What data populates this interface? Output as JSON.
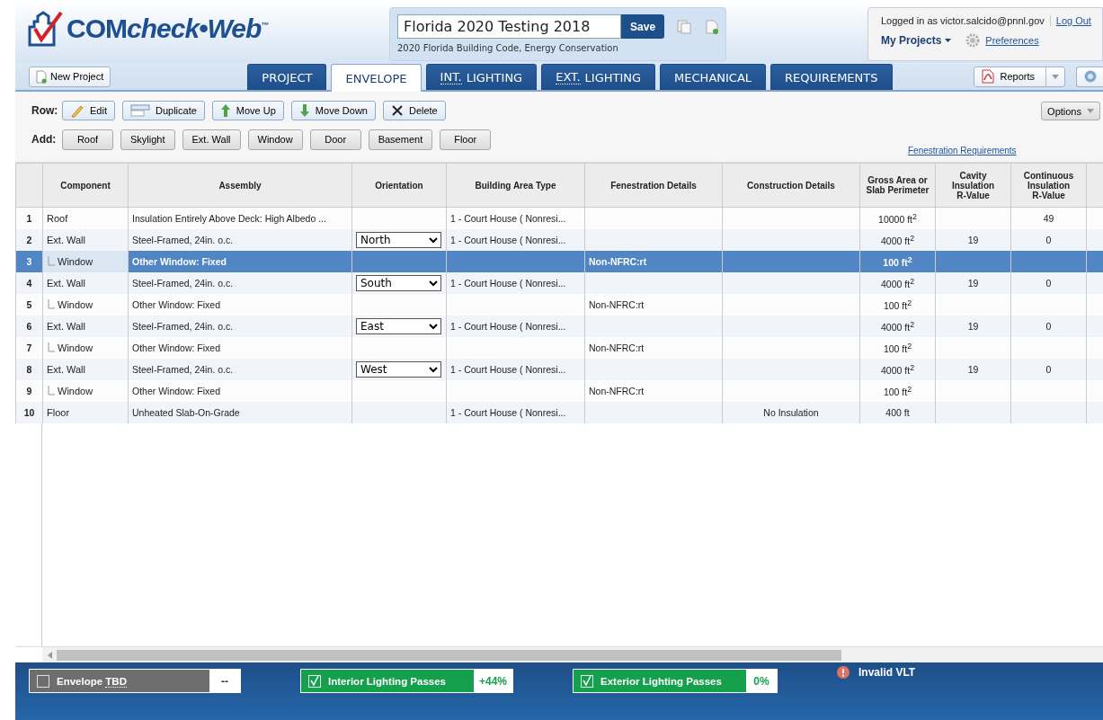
{
  "header": {
    "logo": {
      "main": "COM",
      "rest": "check•Web",
      "tm": "™"
    },
    "project": {
      "name": "Florida 2020 Testing 2018",
      "save": "Save",
      "code": "2020 Florida Building Code, Energy Conservation"
    },
    "user": {
      "logged_in": "Logged in as victor.salcido@pnnl.gov",
      "logout": "Log Out",
      "my_projects": "My Projects",
      "preferences": "Preferences"
    }
  },
  "new_project": "New Project",
  "tabs": [
    {
      "label": "PROJECT",
      "selected": false
    },
    {
      "label": "ENVELOPE",
      "selected": true
    },
    {
      "abbr": "INT.",
      "label": "LIGHTING",
      "selected": false
    },
    {
      "abbr": "EXT.",
      "label": "LIGHTING",
      "selected": false
    },
    {
      "label": "MECHANICAL",
      "selected": false
    },
    {
      "label": "REQUIREMENTS",
      "selected": false
    }
  ],
  "reports": "Reports",
  "row_toolbar": {
    "label": "Row:",
    "buttons": [
      {
        "kind": "edit",
        "label": "Edit"
      },
      {
        "kind": "duplicate",
        "label": "Duplicate"
      },
      {
        "kind": "up",
        "label": "Move Up"
      },
      {
        "kind": "down",
        "label": "Move Down"
      },
      {
        "kind": "delete",
        "label": "Delete"
      }
    ]
  },
  "add_toolbar": {
    "label": "Add:",
    "buttons": [
      "Roof",
      "Skylight",
      "Ext. Wall",
      "Window",
      "Door",
      "Basement",
      "Floor"
    ]
  },
  "options": "Options",
  "fenestration_link": "Fenestration Requirements",
  "table": {
    "columns": [
      "Component",
      "Assembly",
      "Orientation",
      "Building Area Type",
      "Fenestration Details",
      "Construction Details",
      "Gross Area or Slab Perimeter",
      "Cavity Insulation R-Value",
      "Continuous Insulation R-Value"
    ],
    "rows": [
      {
        "num": "1",
        "child": false,
        "selected": false,
        "component": "Roof",
        "assembly": "Insulation Entirely Above Deck: High Albedo ...",
        "orientation": "",
        "area_type": "1 - Court House ( Nonresi...",
        "fenestration": "",
        "construction": "",
        "area": "10000 ft$^{2}$",
        "cavity": "",
        "continuous": "49"
      },
      {
        "num": "2",
        "child": false,
        "selected": false,
        "component": "Ext. Wall",
        "assembly": "Steel-Framed, 24in. o.c.",
        "orientation": "North",
        "area_type": "1 - Court House ( Nonresi...",
        "fenestration": "",
        "construction": "",
        "area": "4000 ft$^{2}$",
        "cavity": "19",
        "continuous": "0"
      },
      {
        "num": "3",
        "child": true,
        "selected": true,
        "component": "Window",
        "assembly": "Other Window: Fixed",
        "orientation": "",
        "area_type": "",
        "fenestration": "Non-NFRC:rt",
        "construction": "",
        "area": "100 ft$^{2}$",
        "cavity": "",
        "continuous": ""
      },
      {
        "num": "4",
        "child": false,
        "selected": false,
        "component": "Ext. Wall",
        "assembly": "Steel-Framed, 24in. o.c.",
        "orientation": "South",
        "area_type": "1 - Court House ( Nonresi...",
        "fenestration": "",
        "construction": "",
        "area": "4000 ft$^{2}$",
        "cavity": "19",
        "continuous": "0"
      },
      {
        "num": "5",
        "child": true,
        "selected": false,
        "component": "Window",
        "assembly": "Other Window: Fixed",
        "orientation": "",
        "area_type": "",
        "fenestration": "Non-NFRC:rt",
        "construction": "",
        "area": "100 ft$^{2}$",
        "cavity": "",
        "continuous": ""
      },
      {
        "num": "6",
        "child": false,
        "selected": false,
        "component": "Ext. Wall",
        "assembly": "Steel-Framed, 24in. o.c.",
        "orientation": "East",
        "area_type": "1 - Court House ( Nonresi...",
        "fenestration": "",
        "construction": "",
        "area": "4000 ft$^{2}$",
        "cavity": "19",
        "continuous": "0"
      },
      {
        "num": "7",
        "child": true,
        "selected": false,
        "component": "Window",
        "assembly": "Other Window: Fixed",
        "orientation": "",
        "area_type": "",
        "fenestration": "Non-NFRC:rt",
        "construction": "",
        "area": "100 ft$^{2}$",
        "cavity": "",
        "continuous": ""
      },
      {
        "num": "8",
        "child": false,
        "selected": false,
        "component": "Ext. Wall",
        "assembly": "Steel-Framed, 24in. o.c.",
        "orientation": "West",
        "area_type": "1 - Court House ( Nonresi...",
        "fenestration": "",
        "construction": "",
        "area": "4000 ft$^{2}$",
        "cavity": "19",
        "continuous": "0"
      },
      {
        "num": "9",
        "child": true,
        "selected": false,
        "component": "Window",
        "assembly": "Other Window: Fixed",
        "orientation": "",
        "area_type": "",
        "fenestration": "Non-NFRC:rt",
        "construction": "",
        "area": "100 ft$^{2}$",
        "cavity": "",
        "continuous": ""
      },
      {
        "num": "10",
        "child": false,
        "selected": false,
        "component": "Floor",
        "assembly": "Unheated Slab-On-Grade",
        "orientation": "",
        "area_type": "1 - Court House ( Nonresi...",
        "fenestration": "",
        "construction": "No Insulation",
        "area": "400 ft",
        "cavity": "",
        "continuous": ""
      }
    ]
  },
  "status_bar": [
    {
      "kind": "status",
      "label": "Envelope",
      "abbr": "TBD",
      "checked": false,
      "color": "#6e6e6e",
      "value": "--"
    },
    {
      "kind": "status",
      "label": "Interior Lighting Passes",
      "checked": true,
      "color": "#15a04d",
      "value": "+44%"
    },
    {
      "kind": "status",
      "label": "Exterior Lighting Passes",
      "checked": true,
      "color": "#15a04d",
      "value": "0%"
    },
    {
      "kind": "alert",
      "label": "Invalid VLT"
    }
  ]
}
